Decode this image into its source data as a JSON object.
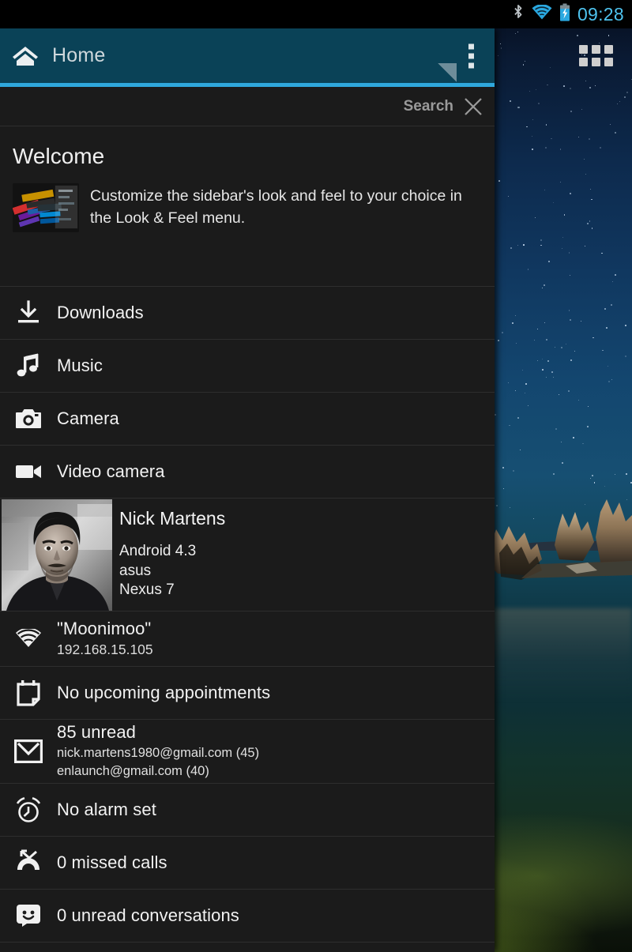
{
  "statusbar": {
    "clock": "09:28",
    "icons": [
      "bluetooth-icon",
      "wifi-icon",
      "battery-charging-icon"
    ],
    "clock_color": "#4ec3ef"
  },
  "homescreen": {
    "app_drawer_label": "app-drawer-grid"
  },
  "sidebar": {
    "header": {
      "title": "Home",
      "home_icon": "home-icon",
      "overflow_icon": "overflow-menu-icon",
      "resize_handle": "resize-handle",
      "bg_color": "#0a4257",
      "accent_color": "#2fa8dd"
    },
    "search": {
      "label": "Search",
      "close_icon": "close-icon"
    },
    "welcome": {
      "title": "Welcome",
      "thumb_icon": "sidebar-preview-thumbnail",
      "text": "Customize the sidebar's look and feel to your choice in the Look & Feel menu."
    },
    "shortcuts": [
      {
        "label": "Downloads",
        "icon": "download-icon"
      },
      {
        "label": "Music",
        "icon": "music-note-icon"
      },
      {
        "label": "Camera",
        "icon": "camera-icon"
      },
      {
        "label": "Video camera",
        "icon": "video-camera-icon"
      }
    ],
    "profile": {
      "avatar": "user-avatar-photo",
      "name": "Nick Martens",
      "os": "Android 4.3",
      "manufacturer": "asus",
      "model": "Nexus 7"
    },
    "wifi": {
      "icon": "wifi-icon",
      "ssid": "\"Moonimoo\"",
      "ip": "192.168.15.105"
    },
    "calendar": {
      "icon": "calendar-icon",
      "title": "No upcoming appointments"
    },
    "gmail": {
      "icon": "gmail-icon",
      "title": "85 unread",
      "account1": "nick.martens1980@gmail.com (45)",
      "account2": "enlaunch@gmail.com (40)"
    },
    "alarm": {
      "icon": "alarm-clock-icon",
      "title": "No alarm set"
    },
    "calls": {
      "icon": "missed-call-icon",
      "title": "0 missed calls"
    },
    "messages": {
      "icon": "sms-smiley-icon",
      "title": "0 unread conversations"
    }
  }
}
